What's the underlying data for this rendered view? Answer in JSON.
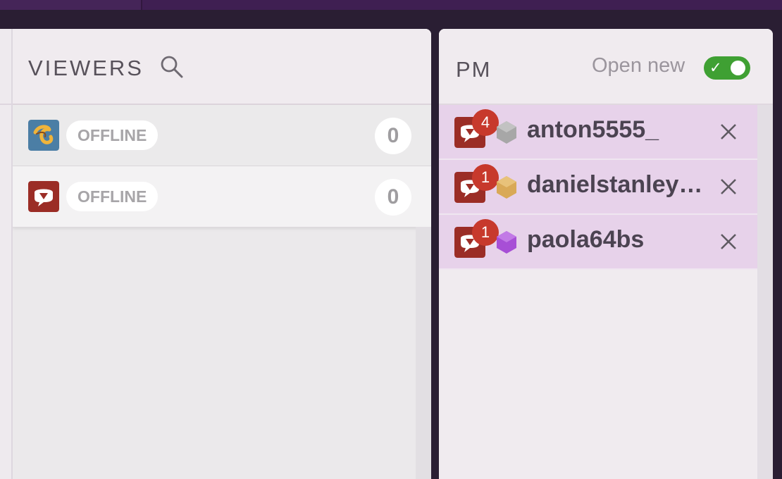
{
  "viewers": {
    "title": "VIEWERS",
    "items": [
      {
        "app": "yellow-swirl-app-icon",
        "status": "OFFLINE",
        "count": "0"
      },
      {
        "app": "chat-bubble-app-icon",
        "status": "OFFLINE",
        "count": "0"
      }
    ]
  },
  "pm": {
    "title": "PM",
    "open_new_label": "Open new",
    "open_new_enabled": true,
    "items": [
      {
        "badge": "4",
        "rank_color": "#a7a7a7",
        "username": "anton5555_"
      },
      {
        "badge": "1",
        "rank_color": "#d9a957",
        "username": "danielstanley…"
      },
      {
        "badge": "1",
        "rank_color": "#a74fd6",
        "username": "paola64bs"
      }
    ]
  },
  "colors": {
    "accent_toggle": "#3fa033",
    "pm_item_bg": "#e7d2ea",
    "badge": "#c7392c",
    "chat_icon": "#9b2d26"
  },
  "icons": {
    "search": "search-icon",
    "close": "close-icon",
    "check": "check-icon"
  }
}
